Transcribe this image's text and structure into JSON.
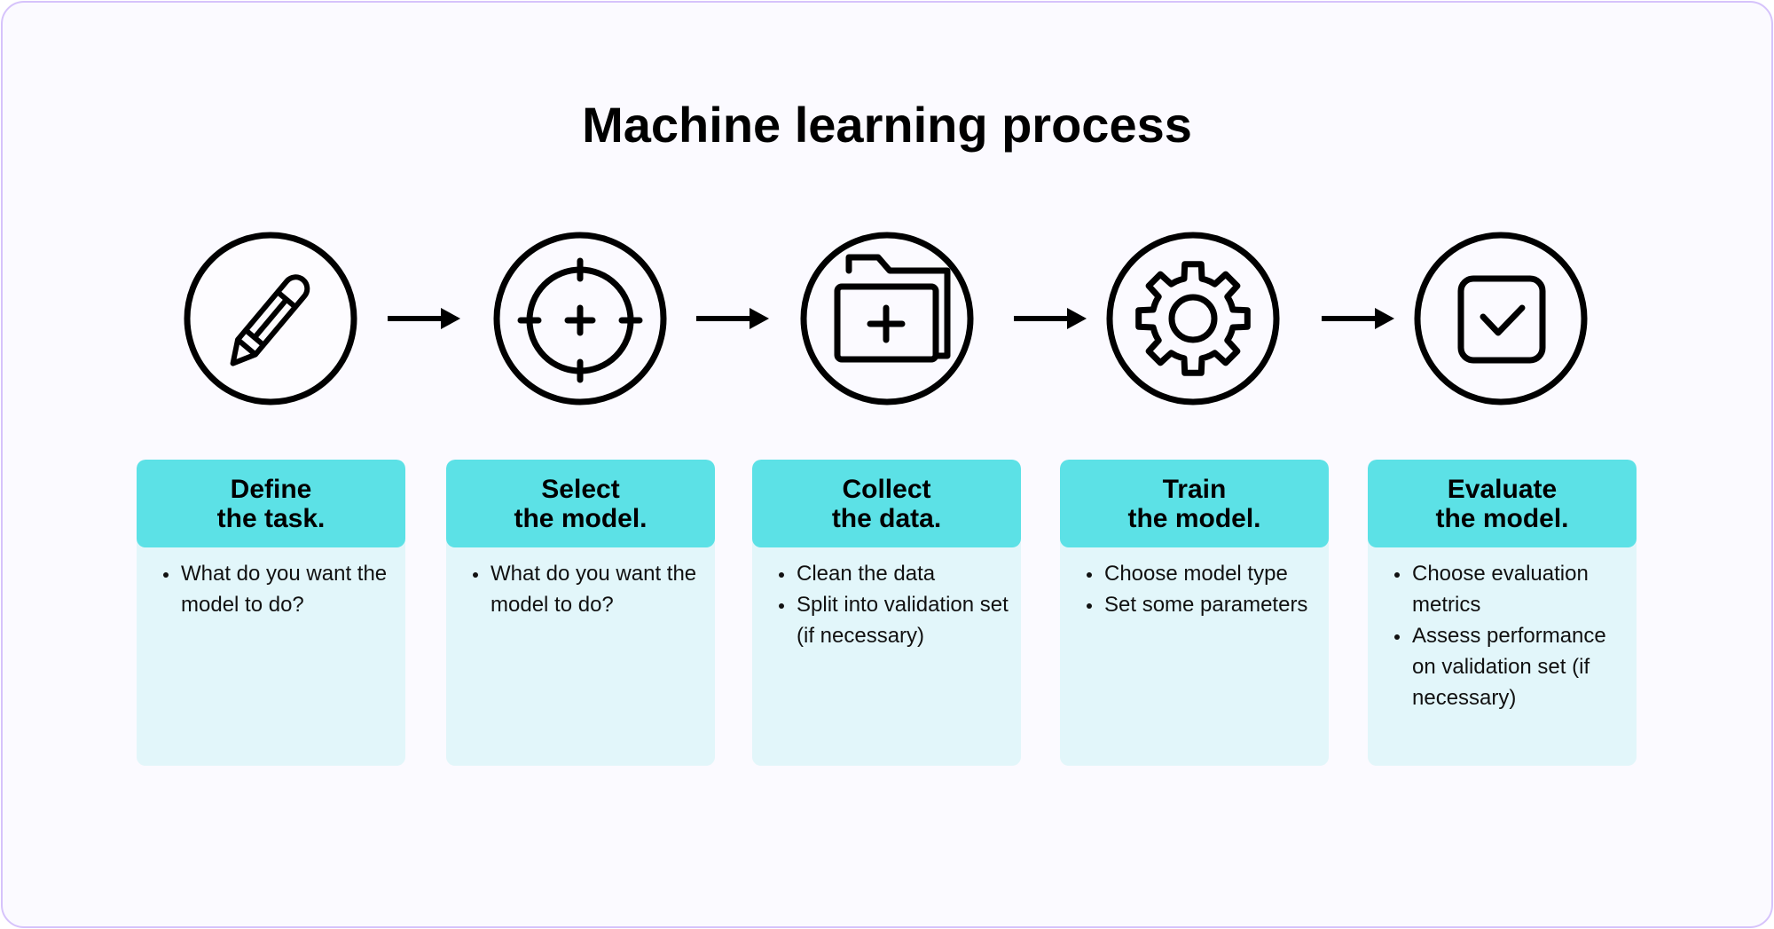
{
  "title": "Machine learning process",
  "colors": {
    "background": "#fbfaff",
    "frame_border": "#d6c3fb",
    "card_header": "#5ce1e6",
    "card_body": "#e2f6fa",
    "icon_stroke": "#000000"
  },
  "steps": [
    {
      "icon": "pencil-icon",
      "title_line1": "Define",
      "title_line2": "the task.",
      "bullets": [
        "What do you want the model to do?"
      ]
    },
    {
      "icon": "crosshair-target-icon",
      "title_line1": "Select",
      "title_line2": "the model.",
      "bullets": [
        "What do you want the model to do?"
      ]
    },
    {
      "icon": "folder-add-icon",
      "title_line1": "Collect",
      "title_line2": "the data.",
      "bullets": [
        "Clean the data",
        "Split into validation set (if necessary)"
      ]
    },
    {
      "icon": "gear-icon",
      "title_line1": "Train",
      "title_line2": "the model.",
      "bullets": [
        "Choose model type",
        "Set some parameters"
      ]
    },
    {
      "icon": "checkbox-check-icon",
      "title_line1": "Evaluate",
      "title_line2": "the model.",
      "bullets": [
        "Choose evaluation metrics",
        "Assess performance on validation set (if necessary)"
      ]
    }
  ],
  "connector_icon": "arrow-right-icon"
}
